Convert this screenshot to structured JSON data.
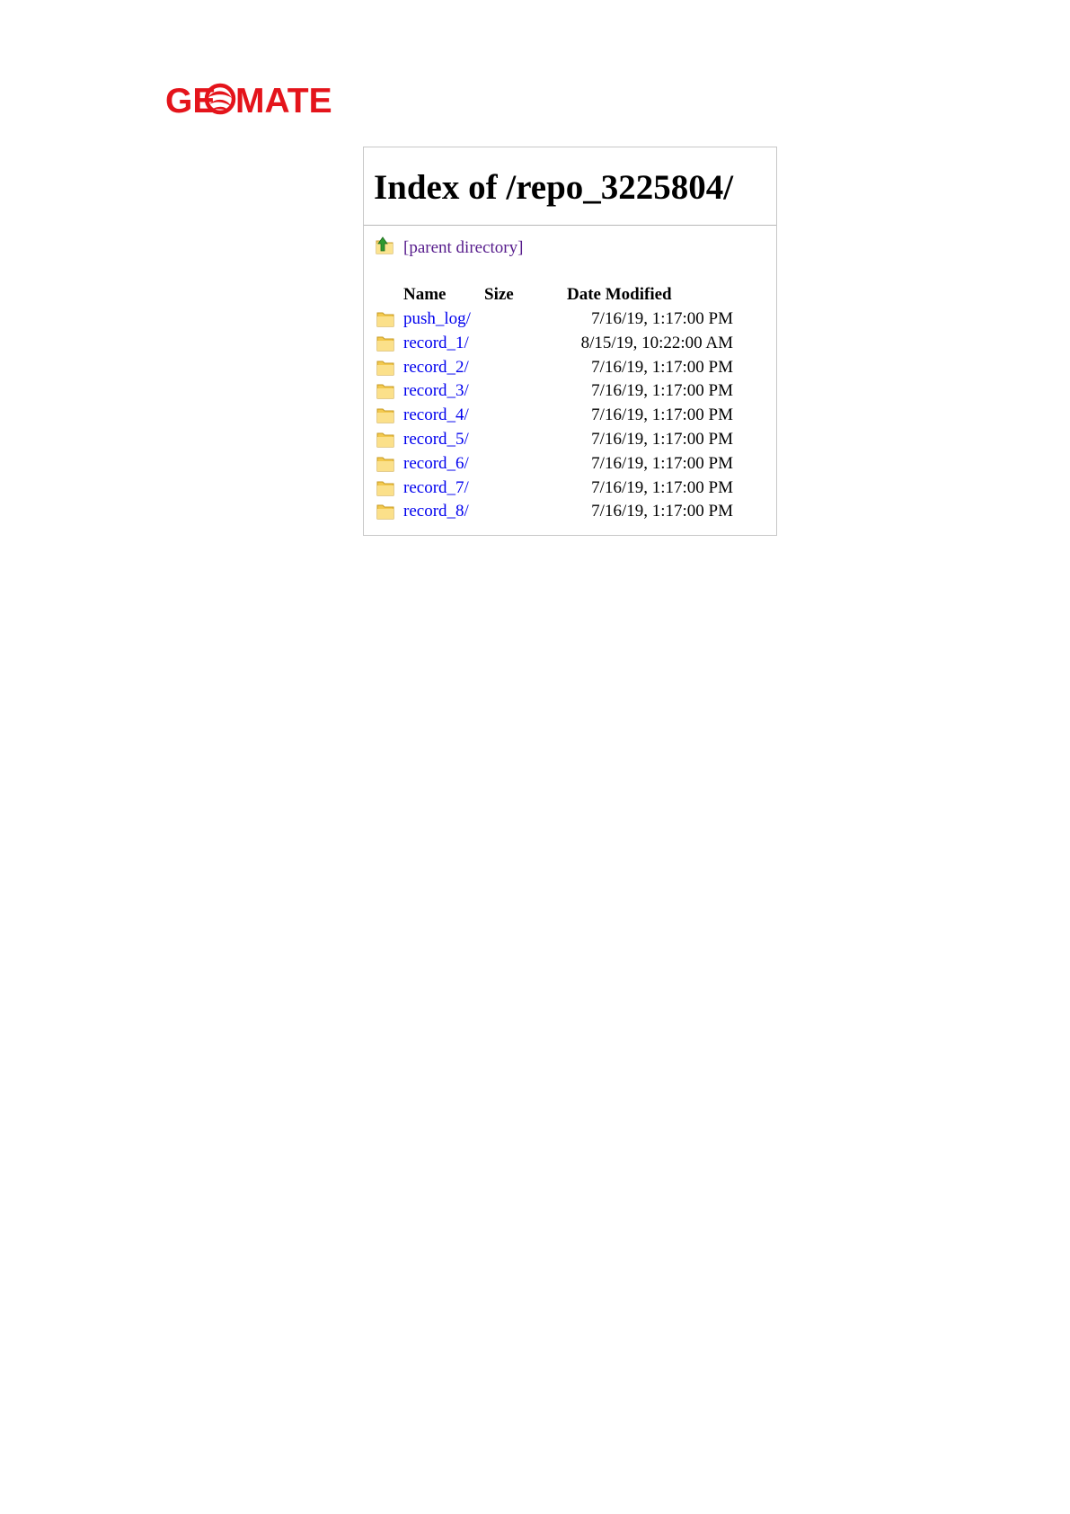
{
  "logo": {
    "text": "GEMATE",
    "color": "#e4141b"
  },
  "listing": {
    "title": "Index of /repo_3225804/",
    "parent_link": "[parent directory]",
    "parent_icon": "up-arrow-folder-icon",
    "headers": {
      "name": "Name",
      "size": "Size",
      "date": "Date Modified"
    },
    "entries": [
      {
        "name": "push_log/",
        "size": "",
        "date": "7/16/19, 1:17:00 PM",
        "icon": "folder-icon"
      },
      {
        "name": "record_1/",
        "size": "",
        "date": "8/15/19, 10:22:00 AM",
        "icon": "folder-icon"
      },
      {
        "name": "record_2/",
        "size": "",
        "date": "7/16/19, 1:17:00 PM",
        "icon": "folder-icon"
      },
      {
        "name": "record_3/",
        "size": "",
        "date": "7/16/19, 1:17:00 PM",
        "icon": "folder-icon"
      },
      {
        "name": "record_4/",
        "size": "",
        "date": "7/16/19, 1:17:00 PM",
        "icon": "folder-icon"
      },
      {
        "name": "record_5/",
        "size": "",
        "date": "7/16/19, 1:17:00 PM",
        "icon": "folder-icon"
      },
      {
        "name": "record_6/",
        "size": "",
        "date": "7/16/19, 1:17:00 PM",
        "icon": "folder-icon"
      },
      {
        "name": "record_7/",
        "size": "",
        "date": "7/16/19, 1:17:00 PM",
        "icon": "folder-icon"
      },
      {
        "name": "record_8/",
        "size": "",
        "date": "7/16/19, 1:17:00 PM",
        "icon": "folder-icon"
      }
    ],
    "link_color": "#0000ee",
    "visited_link_color": "#551a8b"
  }
}
